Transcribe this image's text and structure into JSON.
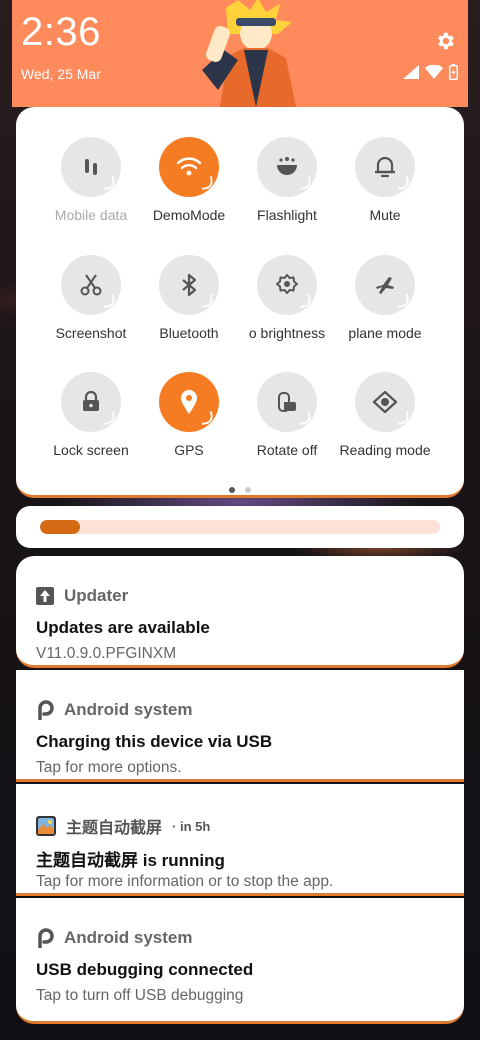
{
  "status_bar": {
    "time": "2:36",
    "date": "Wed, 25 Mar",
    "icons": [
      "signal-icon",
      "wifi-icon",
      "battery-charging-icon"
    ],
    "settings_icon": "gear-icon",
    "header_color": "#ff8a5c"
  },
  "quick_settings": {
    "tiles": [
      {
        "label": "Mobile data",
        "icon": "mobile-data-icon",
        "active": false,
        "disabled": true
      },
      {
        "label": "DemoMode",
        "icon": "wifi-icon",
        "active": true
      },
      {
        "label": "Flashlight",
        "icon": "flashlight-icon",
        "active": false
      },
      {
        "label": "Mute",
        "icon": "bell-icon",
        "active": false
      },
      {
        "label": "Screenshot",
        "icon": "scissors-icon",
        "active": false
      },
      {
        "label": "Bluetooth",
        "icon": "bluetooth-icon",
        "active": false
      },
      {
        "label": "o brightness",
        "icon": "brightness-gear-icon",
        "active": false
      },
      {
        "label": "plane mode",
        "icon": "airplane-icon",
        "active": false
      },
      {
        "label": "Lock screen",
        "icon": "lock-icon",
        "active": false
      },
      {
        "label": "GPS",
        "icon": "location-pin-icon",
        "active": true
      },
      {
        "label": "Rotate off",
        "icon": "rotate-icon",
        "active": false
      },
      {
        "label": "Reading mode",
        "icon": "eye-icon",
        "active": false
      }
    ],
    "active_color": "#f57c22",
    "page_count": 2,
    "current_page": 1
  },
  "brightness": {
    "level": 0.1,
    "fill_color": "#d66a14",
    "track_color": "#fde0d6"
  },
  "notifications": [
    {
      "app": "Updater",
      "icon": "arrow-up-icon",
      "time": "",
      "title": "Updates are available",
      "text": "V11.0.9.0.PFGINXM"
    },
    {
      "app": "Android system",
      "icon": "android-p-icon",
      "time": "",
      "title": "Charging this device via USB",
      "text": "Tap for more options."
    },
    {
      "app": "主题自动截屏",
      "icon": "app-thumbnail-icon",
      "time": "· in 5h",
      "title": "主题自动截屏 is running",
      "text": "Tap for more information or to stop the app."
    },
    {
      "app": "Android system",
      "icon": "android-p-icon",
      "time": "",
      "title": "USB debugging connected",
      "text": "Tap to turn off USB debugging"
    }
  ]
}
